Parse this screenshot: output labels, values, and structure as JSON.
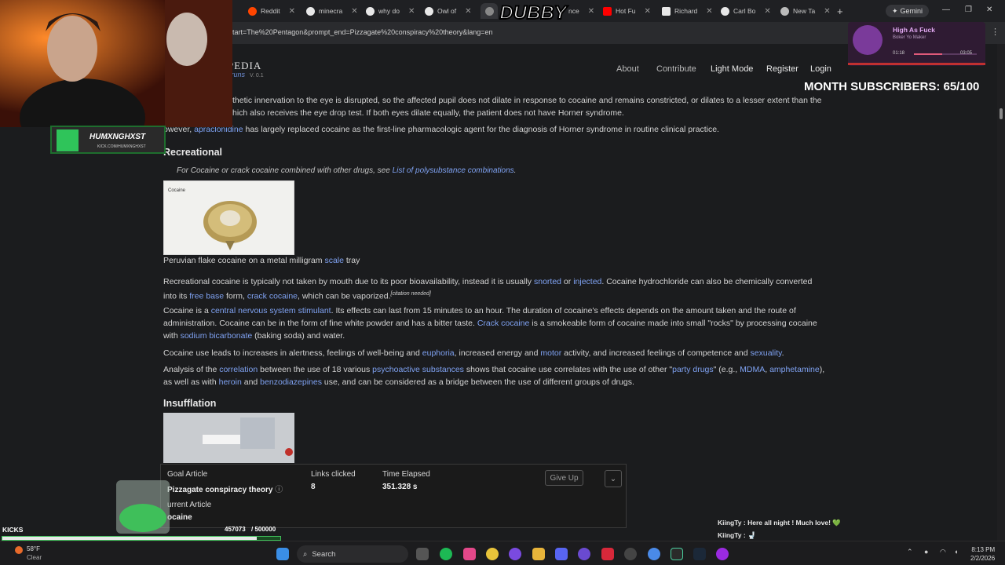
{
  "browser": {
    "tabs": [
      {
        "label": "Reddit",
        "color": "#ff4500"
      },
      {
        "label": "minecra",
        "color": "#dddddd"
      },
      {
        "label": "why do",
        "color": "#dddddd"
      },
      {
        "label": "Owl of",
        "color": "#dddddd"
      },
      {
        "label": "",
        "color": "#888888"
      },
      {
        "label": "nce",
        "color": "#dddddd"
      },
      {
        "label": "Hot Fu",
        "color": "#ff0000"
      },
      {
        "label": "Richard",
        "color": "#dddddd"
      },
      {
        "label": "Carl Bo",
        "color": "#dddddd"
      },
      {
        "label": "New Ta",
        "color": "#dddddd"
      }
    ],
    "url": "tart=The%20Pentagon&prompt_end=Pizzagate%20conspiracy%20theory&lang=en",
    "gemini_label": "Gemini"
  },
  "site": {
    "logo": "PEDIA",
    "logo_sub": "truns",
    "version": "V. 0.1",
    "nav": [
      "About",
      "Contribute",
      "Light Mode",
      "Register",
      "Login"
    ]
  },
  "overlay": {
    "subscribers": "MONTH SUBSCRIBERS: 65/100",
    "streamer_name": "DUBBY",
    "cam_tag": "HUMXNGHXST",
    "cam_tag_sub": "KICK.COM/HUMXNGHXST",
    "song_title": "High As Fuck",
    "song_artist": "Boker Yo Maker",
    "song_elapsed": "01:18",
    "song_total": "03:05",
    "kicks_label": "KICKS",
    "kicks_progress": "457073",
    "kicks_goal": "/ 500000",
    "chat": [
      {
        "user": "KiingTy",
        "text": ": Here all night ! Much love! 💚"
      },
      {
        "user": "KiingTy",
        "text": ": 🚽"
      }
    ]
  },
  "article": {
    "p0_line1": "thetic innervation to the eye is disrupted, so the affected pupil does not dilate in response to cocaine and remains constricted, or dilates to a lesser extent than the",
    "p0_line2": "hich also receives the eye drop test. If both eyes dilate equally, the patient does not have Horner syndrome.",
    "p1_pre": "owever, ",
    "p1_link": "apraclonidine",
    "p1_post": " has largely replaced cocaine as the first-line pharmacologic agent for the diagnosis of Horner syndrome in routine clinical practice.",
    "section_recreational": "Recreational",
    "hatnote_pre": "For Cocaine or crack cocaine combined with other drugs, see ",
    "hatnote_link": "List of polysubstance combinations",
    "hatnote_post": ".",
    "image1_label": "Cocaine",
    "caption_pre": "Peruvian flake cocaine on a metal milligram ",
    "caption_link": "scale",
    "caption_post": " tray",
    "p2": {
      "a": "Recreational cocaine is typically not taken by mouth due to its poor bioavailability, instead it is usually ",
      "l1": "snorted",
      "b": " or ",
      "l2": "injected",
      "c": ". Cocaine hydrochloride can also be chemically converted",
      "d": "into its ",
      "l3": "free base",
      "e": " form, ",
      "l4": "crack cocaine",
      "f": ", which can be vaporized.",
      "cn": "[citation needed]"
    },
    "p3": {
      "a": "Cocaine is a ",
      "l1": "central nervous system stimulant",
      "b": ". Its effects can last from 15 minutes to an hour. The duration of cocaine's effects depends on the amount taken and the route of",
      "c": "administration. Cocaine can be in the form of fine white powder and has a bitter taste. ",
      "l2": "Crack cocaine",
      "d": " is a smokeable form of cocaine made into small \"rocks\" by processing cocaine",
      "e": "with ",
      "l3": "sodium bicarbonate",
      "f": " (baking soda) and water."
    },
    "p4": {
      "a": "Cocaine use leads to increases in alertness, feelings of well-being and ",
      "l1": "euphoria",
      "b": ", increased energy and ",
      "l2": "motor",
      "c": " activity, and increased feelings of competence and ",
      "l3": "sexuality",
      "d": "."
    },
    "p5": {
      "a": "Analysis of the ",
      "l1": "correlation",
      "b": " between the use of 18 various ",
      "l2": "psychoactive substances",
      "c": " shows that cocaine use correlates with the use of other \"",
      "l3": "party drugs",
      "d": "\" (e.g., ",
      "l4": "MDMA",
      "e": ", ",
      "l5": "amphetamine",
      "f": "),",
      "g": "as well as with ",
      "l6": "heroin",
      "h": " and ",
      "l7": "benzodiazepines",
      "i": " use, and can be considered as a bridge between the use of different groups of drugs."
    },
    "section_insufflation": "Insufflation"
  },
  "game": {
    "goal_label": "Goal Article",
    "goal_value": "Pizzagate conspiracy theory",
    "links_label": "Links clicked",
    "links_value": "8",
    "time_label": "Time Elapsed",
    "time_value": "351.328 s",
    "current_label": "urrent Article",
    "current_value": "ocaine",
    "giveup_label": "Give Up"
  },
  "taskbar": {
    "weather_temp": "58°F",
    "weather_desc": "Clear",
    "search_placeholder": "Search",
    "time": "8:13 PM",
    "date": "2/2/2026"
  }
}
